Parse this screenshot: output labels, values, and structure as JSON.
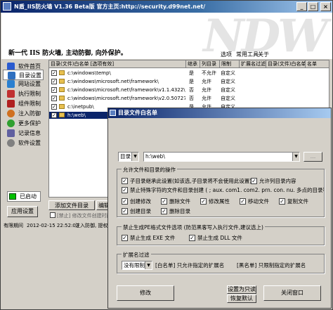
{
  "window": {
    "title": "N盾_IIS防火墙 V1.36 Beta版    官方主页:http://security.d99net.net/",
    "minimize": "_",
    "maximize": "□",
    "close": "×"
  },
  "banner": {
    "logo": "NDW",
    "slogan": "新一代 IIS 防火墙, 主动防御, 向外保护。"
  },
  "menu": [
    "选项",
    "常用工具",
    "关于"
  ],
  "sidebar": {
    "items": [
      {
        "label": "软件首页",
        "color": "#2a5bd0"
      },
      {
        "label": "目录设置",
        "color": "#3070c0"
      },
      {
        "label": "网站设置",
        "color": "#2a80d0"
      },
      {
        "label": "执行限制",
        "color": "#c03030"
      },
      {
        "label": "组件限制",
        "color": "#b02020"
      },
      {
        "label": "注入防御",
        "color": "#d07020"
      },
      {
        "label": "更多保护",
        "color": "#30a030"
      },
      {
        "label": "记录信息",
        "color": "#6060a0"
      },
      {
        "label": "软件设置",
        "color": "#808080"
      }
    ],
    "selected_index": 1,
    "status": "已启动",
    "apply_button": "应用设置"
  },
  "table": {
    "columns": [
      "目录(文件)白名单 [选项有效]",
      "继承",
      "列目录",
      "限制",
      "扩展名过滤",
      "目录(文件)白名单",
      "名单"
    ],
    "rows": [
      {
        "path": "c:\\windows\\temp\\",
        "inherit": "是",
        "list": "不允许",
        "limit": "自定义",
        "selected": false
      },
      {
        "path": "c:\\windows\\microsoft.net\\framework\\",
        "inherit": "是",
        "list": "允许",
        "limit": "自定义",
        "selected": false
      },
      {
        "path": "c:\\windows\\microsoft.net\\framework\\v1.1.4322\\temp...",
        "inherit": "否",
        "list": "允许",
        "limit": "自定义",
        "selected": false
      },
      {
        "path": "c:\\windows\\microsoft.net\\framework\\v2.0.50727\\tem...",
        "inherit": "否",
        "list": "允许",
        "limit": "自定义",
        "selected": false
      },
      {
        "path": "c:\\inetpub\\",
        "inherit": "是",
        "list": "允许",
        "limit": "自定义",
        "selected": false
      },
      {
        "path": "h:\\web\\",
        "inherit": "是",
        "list": "允许",
        "limit": "默认",
        "selected": true
      }
    ]
  },
  "bottom": {
    "add_button": "添加文件目录",
    "edit_button": "编辑",
    "extra_checkbox": "[禁止] 修改文件创建时间"
  },
  "statusbar": {
    "state": "有限期间",
    "timestamp": "2012-02-15 22:52:03",
    "message": "注入防御, 提权保护 ..."
  },
  "dialog": {
    "title": "目录文件白名单",
    "type_select": "目录",
    "path_value": "h:\\web\\",
    "browse_button": "...",
    "group1_label": "允许文件和目录的操作",
    "opt_inherit": "子目录继承此设置(如该选,子目录将不会使用此设置)",
    "opt_list": "允许列目录内容",
    "opt_block_special": "禁止特殊字符的文件和目录创建 ( ; aux. com1. com2. prn. con. nu. 多点的目录等)",
    "ops": [
      "创建修改",
      "删除文件",
      "修改属性",
      "移动文件",
      "复制文件",
      "创建目录",
      "删除目录"
    ],
    "group2_label": "禁止生成PE格式文件选项 (防范黑客写入执行文件,建议选上)",
    "opt_exe": "禁止生成 EXE 文件",
    "opt_dll": "禁止生成 DLL 文件",
    "group3_label": "扩展名过滤",
    "filter_select": "没有限制",
    "white_hint": "[白名单] 只允许指定的扩展名",
    "black_hint": "[黑名单] 只限制指定的扩展名",
    "modify_button": "修改",
    "readonly_button": "设置为只读",
    "restore_button": "恢复默认",
    "close_button": "关闭窗口"
  }
}
